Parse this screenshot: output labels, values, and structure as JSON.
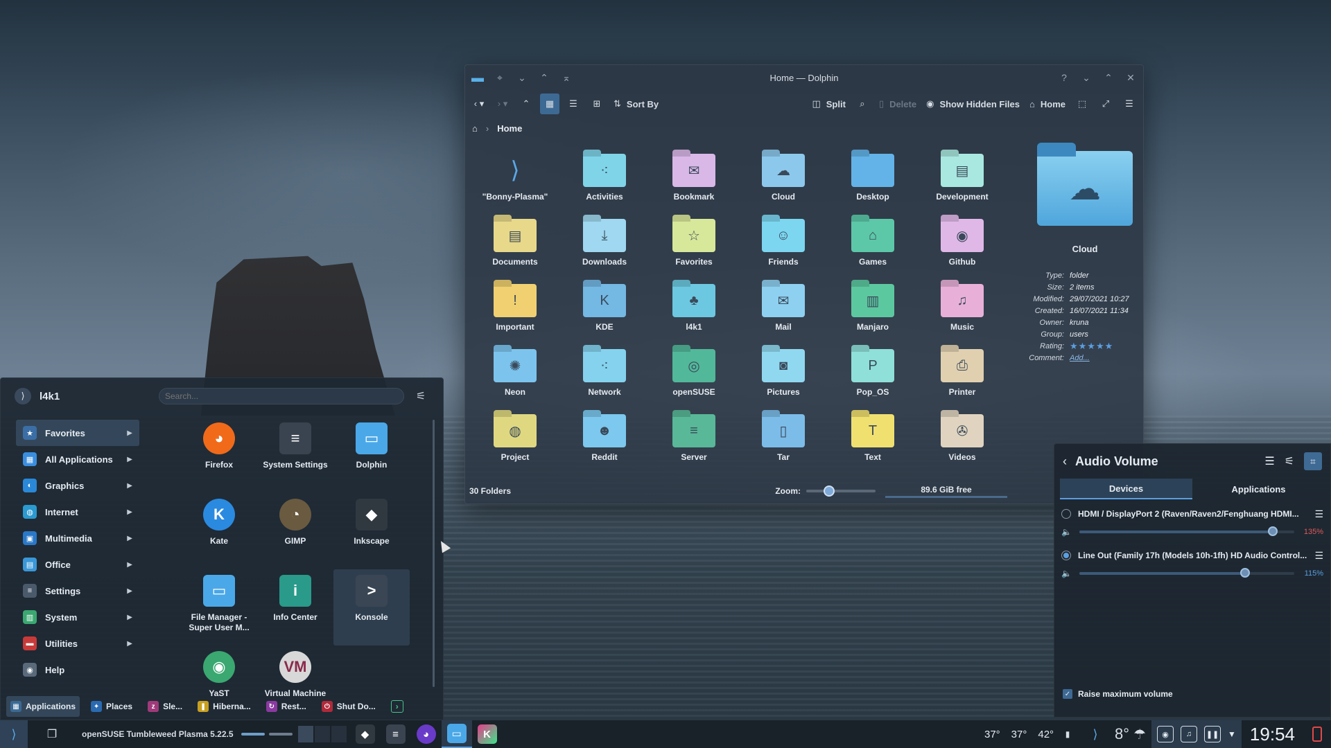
{
  "dolphin": {
    "title": "Home — Dolphin",
    "toolbar": {
      "sort_by": "Sort By",
      "split": "Split",
      "delete": "Delete",
      "show_hidden": "Show Hidden Files",
      "home": "Home"
    },
    "breadcrumb": "Home",
    "folders": [
      {
        "name": "\"Bonny-Plasma\"",
        "color": "#1e2a38",
        "glyph": "⟩"
      },
      {
        "name": "Activities",
        "color": "#7fd4e8",
        "glyph": "⁖"
      },
      {
        "name": "Bookmark",
        "color": "#d9b8e8",
        "glyph": "✉"
      },
      {
        "name": "Cloud",
        "color": "#8cc8ec",
        "glyph": "☁"
      },
      {
        "name": "Desktop",
        "color": "#63b3e8",
        "glyph": ""
      },
      {
        "name": "Development",
        "color": "#a9e8e0",
        "glyph": "▤"
      },
      {
        "name": "Documents",
        "color": "#e8d88a",
        "glyph": "▤"
      },
      {
        "name": "Downloads",
        "color": "#9fd8f0",
        "glyph": "⤓"
      },
      {
        "name": "Favorites",
        "color": "#d8e89a",
        "glyph": "☆"
      },
      {
        "name": "Friends",
        "color": "#7cd6f0",
        "glyph": "☺"
      },
      {
        "name": "Games",
        "color": "#5cc8a8",
        "glyph": "⌂"
      },
      {
        "name": "Github",
        "color": "#e0b8e8",
        "glyph": "◉"
      },
      {
        "name": "Important",
        "color": "#f0d070",
        "glyph": "!"
      },
      {
        "name": "KDE",
        "color": "#74b8e4",
        "glyph": "K"
      },
      {
        "name": "l4k1",
        "color": "#6cc8e0",
        "glyph": "♣"
      },
      {
        "name": "Mail",
        "color": "#8ed0f0",
        "glyph": "✉"
      },
      {
        "name": "Manjaro",
        "color": "#5cc8a0",
        "glyph": "▥"
      },
      {
        "name": "Music",
        "color": "#e8b0d8",
        "glyph": "♫"
      },
      {
        "name": "Neon",
        "color": "#7cc4ee",
        "glyph": "✺"
      },
      {
        "name": "Network",
        "color": "#84d2ee",
        "glyph": "⁖"
      },
      {
        "name": "openSUSE",
        "color": "#52b89a",
        "glyph": "◎"
      },
      {
        "name": "Pictures",
        "color": "#90d8f0",
        "glyph": "◙"
      },
      {
        "name": "Pop_OS",
        "color": "#8ee0d8",
        "glyph": "P"
      },
      {
        "name": "Printer",
        "color": "#e0d0b0",
        "glyph": "⎙"
      },
      {
        "name": "Project",
        "color": "#e0d880",
        "glyph": "◍"
      },
      {
        "name": "Reddit",
        "color": "#7cc8ee",
        "glyph": "☻"
      },
      {
        "name": "Server",
        "color": "#58b898",
        "glyph": "≡"
      },
      {
        "name": "Tar",
        "color": "#7cbce8",
        "glyph": "▯"
      },
      {
        "name": "Text",
        "color": "#f0e070",
        "glyph": "T"
      },
      {
        "name": "Videos",
        "color": "#e0d4c0",
        "glyph": "✇"
      }
    ],
    "status": {
      "count": "30 Folders",
      "zoom_label": "Zoom:",
      "zoom_level": 0.3,
      "free": "89.6 GiB free"
    },
    "info": {
      "name": "Cloud",
      "rows": [
        {
          "k": "Type:",
          "v": "folder"
        },
        {
          "k": "Size:",
          "v": "2 items"
        },
        {
          "k": "Modified:",
          "v": "29/07/2021 10:27"
        },
        {
          "k": "Created:",
          "v": "16/07/2021 11:34"
        },
        {
          "k": "Owner:",
          "v": "kruna"
        },
        {
          "k": "Group:",
          "v": "users"
        }
      ],
      "rating_label": "Rating:",
      "rating": "★★★★★",
      "comment_label": "Comment:",
      "comment_link": "Add..."
    }
  },
  "launcher": {
    "user": "l4k1",
    "search_placeholder": "Search...",
    "categories": [
      {
        "label": "Favorites",
        "color": "#3b6ea5",
        "icon": "★"
      },
      {
        "label": "All Applications",
        "color": "#3a8ee0",
        "icon": "▦"
      },
      {
        "label": "Graphics",
        "color": "#2a88d8",
        "icon": "◐"
      },
      {
        "label": "Internet",
        "color": "#2a9ad0",
        "icon": "◍"
      },
      {
        "label": "Multimedia",
        "color": "#2a78c8",
        "icon": "▣"
      },
      {
        "label": "Office",
        "color": "#3a98d8",
        "icon": "▤"
      },
      {
        "label": "Settings",
        "color": "#4a5a6a",
        "icon": "≡"
      },
      {
        "label": "System",
        "color": "#3aa870",
        "icon": "▥"
      },
      {
        "label": "Utilities",
        "color": "#c83a3a",
        "icon": "▬"
      },
      {
        "label": "Help",
        "color": "#5a6a7a",
        "icon": "◉"
      }
    ],
    "apps": [
      {
        "label": "Firefox",
        "color": "#f06a1a",
        "icon": "◕",
        "shape": "round"
      },
      {
        "label": "System Settings",
        "color": "#3a4450",
        "icon": "≡",
        "shape": "sq"
      },
      {
        "label": "Dolphin",
        "color": "#4aa8e8",
        "icon": "▭",
        "shape": "sq"
      },
      {
        "label": "Kate",
        "color": "#2a8ae0",
        "icon": "K",
        "shape": "round"
      },
      {
        "label": "GIMP",
        "color": "#6a5a40",
        "icon": "◔",
        "shape": "round"
      },
      {
        "label": "Inkscape",
        "color": "#303840",
        "icon": "◆",
        "shape": "sq"
      },
      {
        "label": "File Manager -\nSuper User M...",
        "color": "#4aa8e8",
        "icon": "▭",
        "shape": "sq"
      },
      {
        "label": "Info Center",
        "color": "#2a9a8a",
        "icon": "i",
        "shape": "sq"
      },
      {
        "label": "Konsole",
        "color": "#3a4654",
        "icon": ">",
        "shape": "sq"
      },
      {
        "label": "YaST",
        "color": "#3aa870",
        "icon": "◉",
        "shape": "round"
      },
      {
        "label": "Virtual Machine",
        "color": "#d8d8d8",
        "icon": "VM",
        "shape": "round"
      }
    ],
    "footer": [
      {
        "label": "Applications",
        "color": "#3a6a94",
        "icon": "▦"
      },
      {
        "label": "Places",
        "color": "#2a6ab0",
        "icon": "✦"
      },
      {
        "label": "Sle...",
        "color": "#a03a7a",
        "icon": "z"
      },
      {
        "label": "Hiberna...",
        "color": "#c8a020",
        "icon": "❚"
      },
      {
        "label": "Rest...",
        "color": "#8a3aa0",
        "icon": "↻"
      },
      {
        "label": "Shut Do...",
        "color": "#b02a3a",
        "icon": "⏻"
      }
    ]
  },
  "audio": {
    "title": "Audio Volume",
    "tabs": [
      "Devices",
      "Applications"
    ],
    "devices": [
      {
        "name": "HDMI / DisplayPort 2 (Raven/Raven2/Fenghuang HDMI...",
        "volume_pct": "135%",
        "level": 0.9,
        "active": false
      },
      {
        "name": "Line Out (Family 17h (Models 10h-1fh) HD Audio Control...",
        "volume_pct": "115%",
        "level": 0.77,
        "active": true
      }
    ],
    "raise_label": "Raise maximum volume"
  },
  "panel": {
    "distro": "openSUSE Tumbleweed Plasma 5.22.5",
    "temps": [
      "37°",
      "37°",
      "42°"
    ],
    "weather": "8°",
    "clock": "19:54"
  }
}
